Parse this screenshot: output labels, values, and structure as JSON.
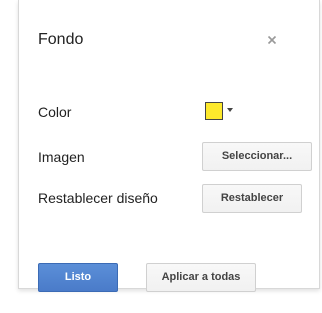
{
  "dialog": {
    "title": "Fondo",
    "close_icon": "close-icon"
  },
  "rows": {
    "color_label": "Color",
    "color_value": "#fde92c",
    "image_label": "Imagen",
    "image_button": "Seleccionar...",
    "reset_label": "Restablecer diseño",
    "reset_button": "Restablecer"
  },
  "footer": {
    "done_button": "Listo",
    "apply_all_button": "Aplicar a todas"
  },
  "colors": {
    "primary": "#4a7bc9",
    "swatch": "#fde92c"
  }
}
